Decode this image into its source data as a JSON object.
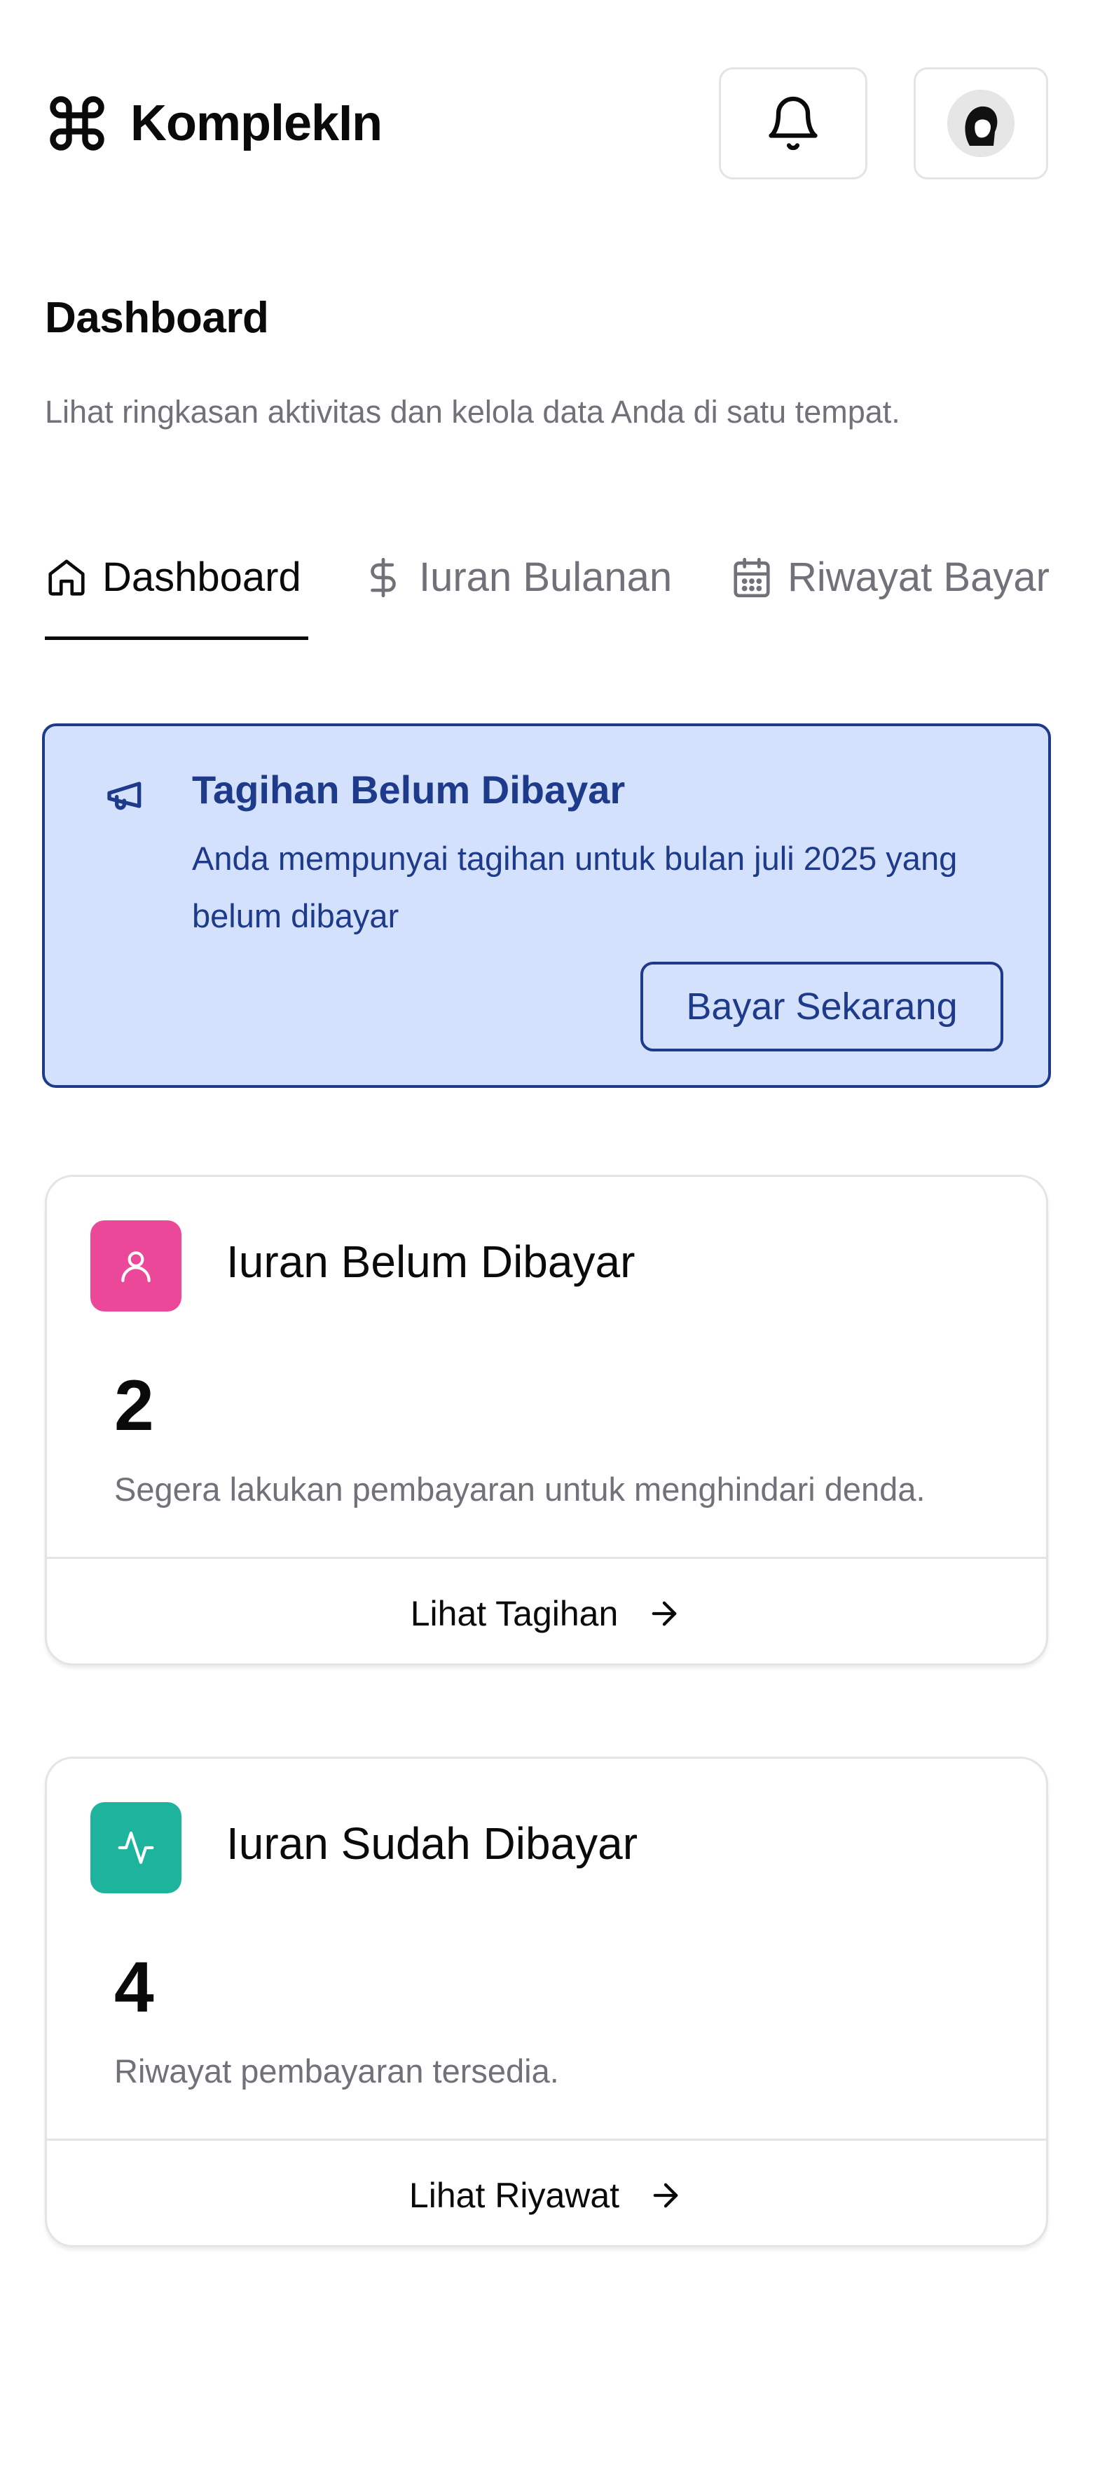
{
  "app": {
    "brand_name": "KomplekIn",
    "brand_icon": "command-icon"
  },
  "header": {
    "notification_icon": "bell-icon",
    "avatar_icon": "avatar"
  },
  "page": {
    "title": "Dashboard",
    "subtitle": "Lihat ringkasan aktivitas dan kelola data Anda di satu tempat."
  },
  "tabs": [
    {
      "label": "Dashboard",
      "icon": "home-icon",
      "active": true
    },
    {
      "label": "Iuran Bulanan",
      "icon": "dollar-icon",
      "active": false
    },
    {
      "label": "Riwayat Bayar",
      "icon": "calendar-icon",
      "active": false
    }
  ],
  "alert": {
    "icon": "megaphone-icon",
    "title": "Tagihan Belum Dibayar",
    "description": "Anda mempunyai tagihan untuk bulan juli 2025 yang belum dibayar",
    "button_label": "Bayar Sekarang"
  },
  "cards": [
    {
      "icon": "user-icon",
      "icon_color": "#ec4899",
      "title": "Iuran Belum Dibayar",
      "value": "2",
      "description": "Segera lakukan pembayaran untuk menghindari denda.",
      "link_label": "Lihat Tagihan"
    },
    {
      "icon": "activity-icon",
      "icon_color": "#1eb39d",
      "title": "Iuran Sudah Dibayar",
      "value": "4",
      "description": "Riwayat pembayaran tersedia.",
      "link_label": "Lihat Riyawat"
    }
  ],
  "colors": {
    "alert_bg": "#d4e1fc",
    "alert_accent": "#1e3a8a",
    "muted_text": "#71717a"
  }
}
